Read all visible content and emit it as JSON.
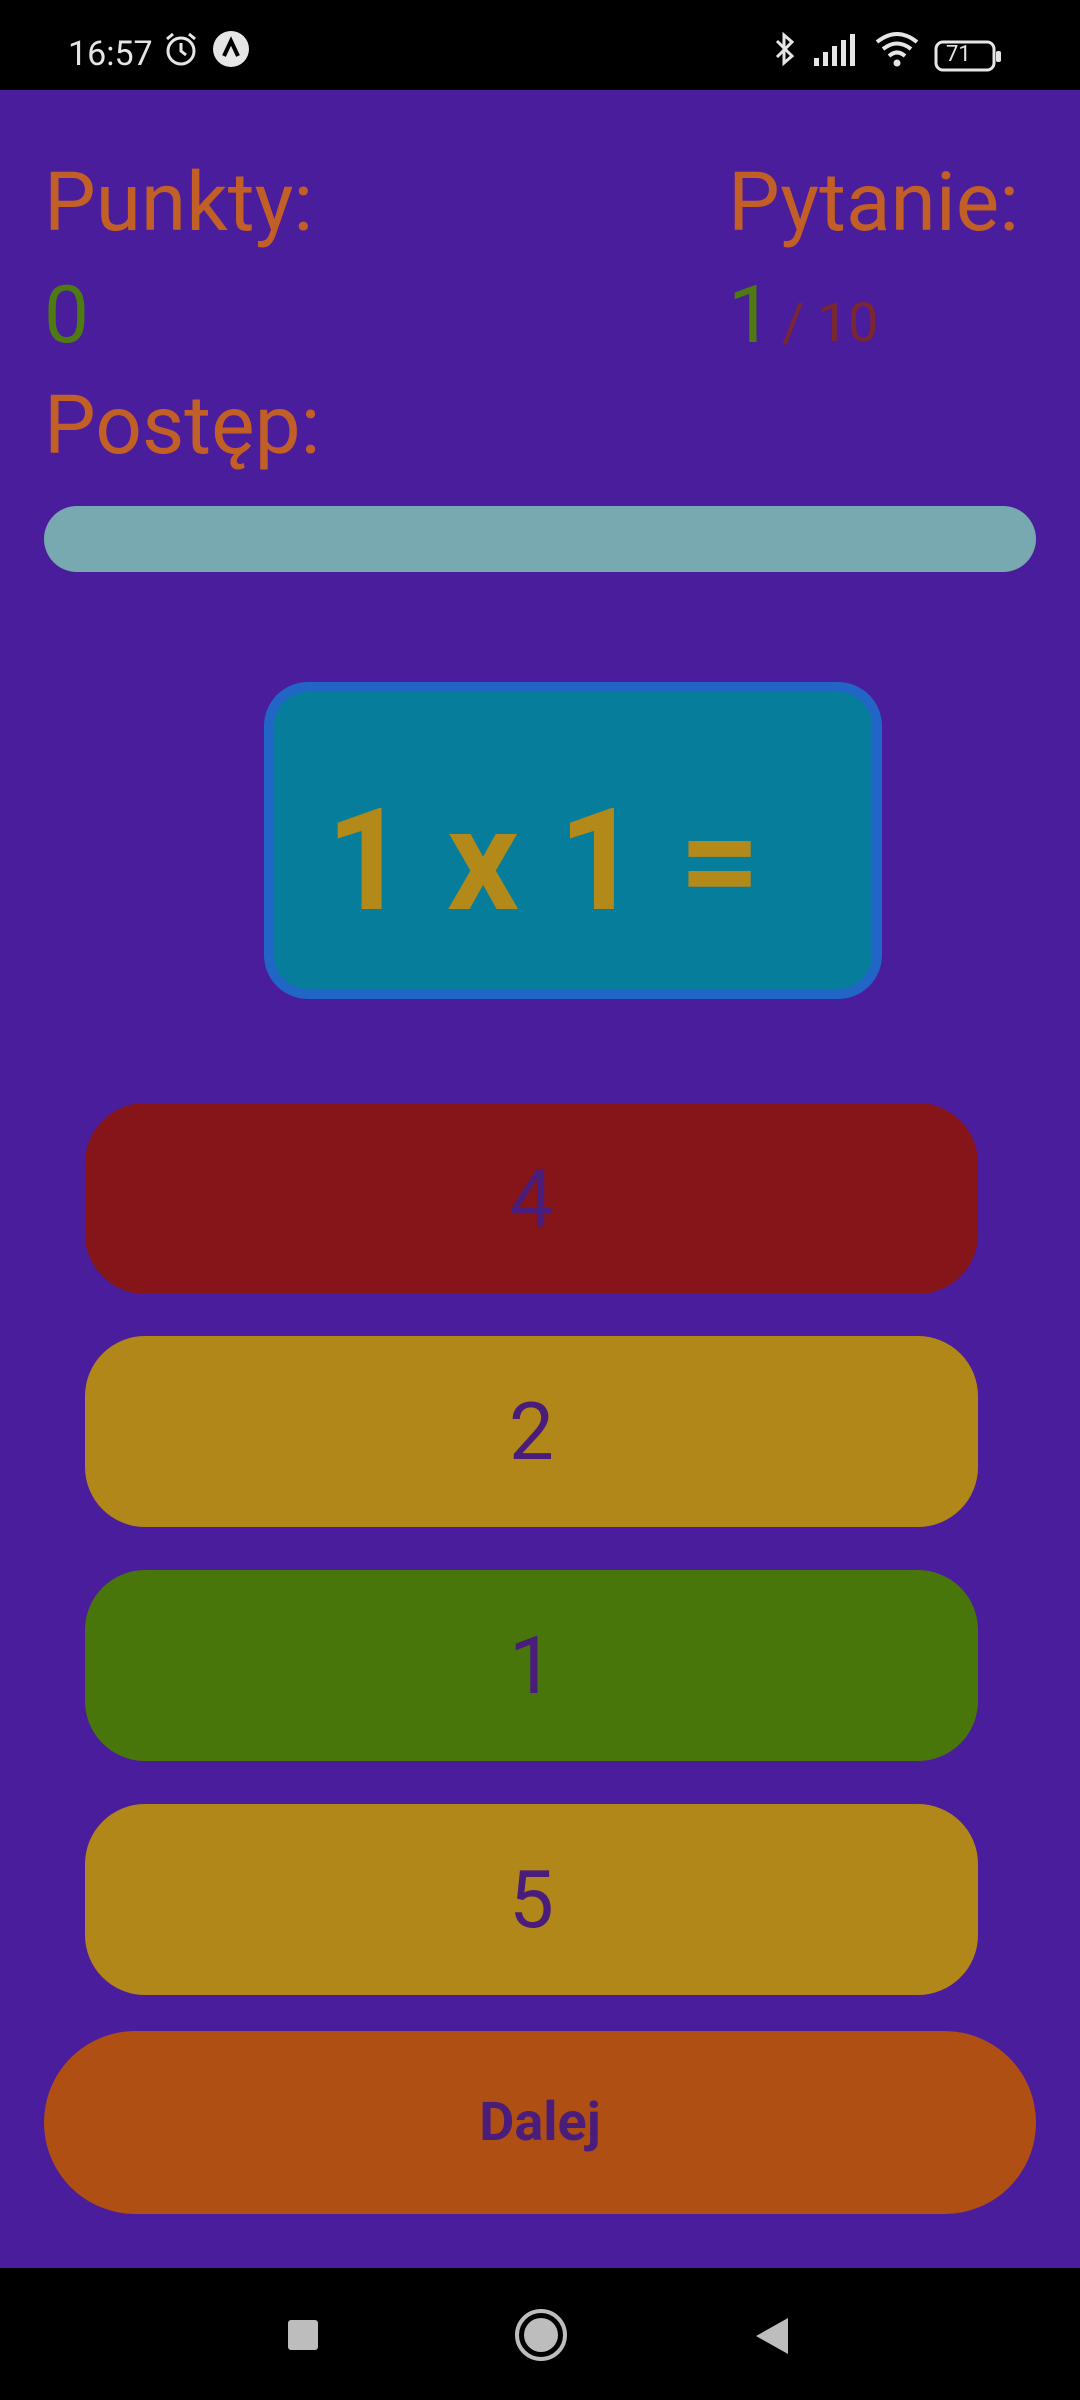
{
  "status_bar": {
    "time": "16:57",
    "battery": "71"
  },
  "header": {
    "points_label": "Punkty:",
    "points_value": "0",
    "question_label": "Pytanie:",
    "question_current": "1",
    "question_total": "/ 10",
    "progress_label": "Postęp:",
    "progress_fraction": 0.0
  },
  "question": {
    "text": "1 x 1 ="
  },
  "answers": [
    {
      "label": "4",
      "color": "#861519"
    },
    {
      "label": "2",
      "color": "#b1871a"
    },
    {
      "label": "1",
      "color": "#48760a"
    },
    {
      "label": "5",
      "color": "#b1871a"
    }
  ],
  "next_button": {
    "label": "Dalej"
  },
  "icons": [
    "alarm-icon",
    "app-notification-icon",
    "bluetooth-icon",
    "signal-icon",
    "wifi-icon",
    "battery-icon",
    "recent-apps-icon",
    "home-icon",
    "back-icon"
  ]
}
